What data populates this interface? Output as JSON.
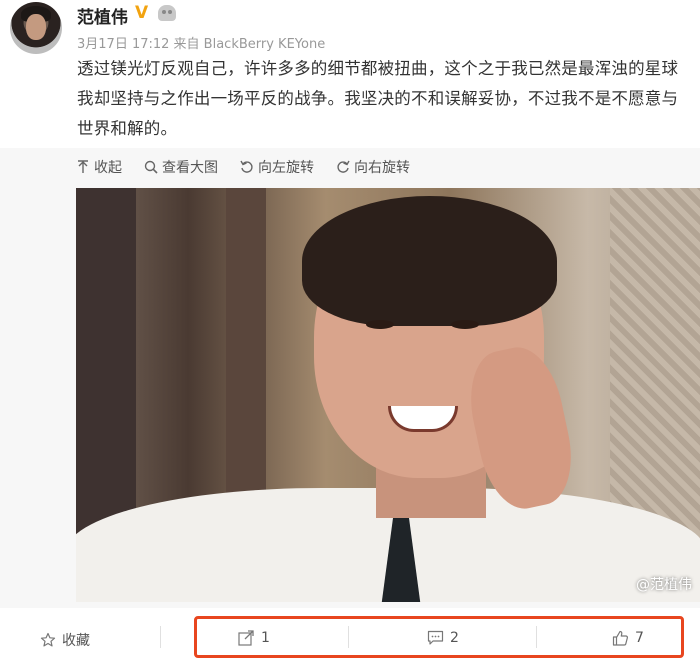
{
  "header": {
    "username": "范植伟",
    "verified_badge": "V",
    "meta": "3月17日 17:12 来自 BlackBerry KEYone"
  },
  "post": {
    "text": "透过镁光灯反观自己，许许多多的细节都被扭曲，这个之于我已然是最浑浊的星球我却坚持与之作出一场平反的战争。我坚决的不和误解妥协，不过我不是不愿意与世界和解的。"
  },
  "toolbar": {
    "collapse": "收起",
    "view_large": "查看大图",
    "rotate_left": "向左旋转",
    "rotate_right": "向右旋转"
  },
  "photo": {
    "watermark": "@范植伟"
  },
  "actions": {
    "favorite": "收藏",
    "repost_count": "1",
    "comment_count": "2",
    "like_count": "7"
  },
  "colors": {
    "highlight": "#e8461f",
    "verified": "#f2a310"
  }
}
